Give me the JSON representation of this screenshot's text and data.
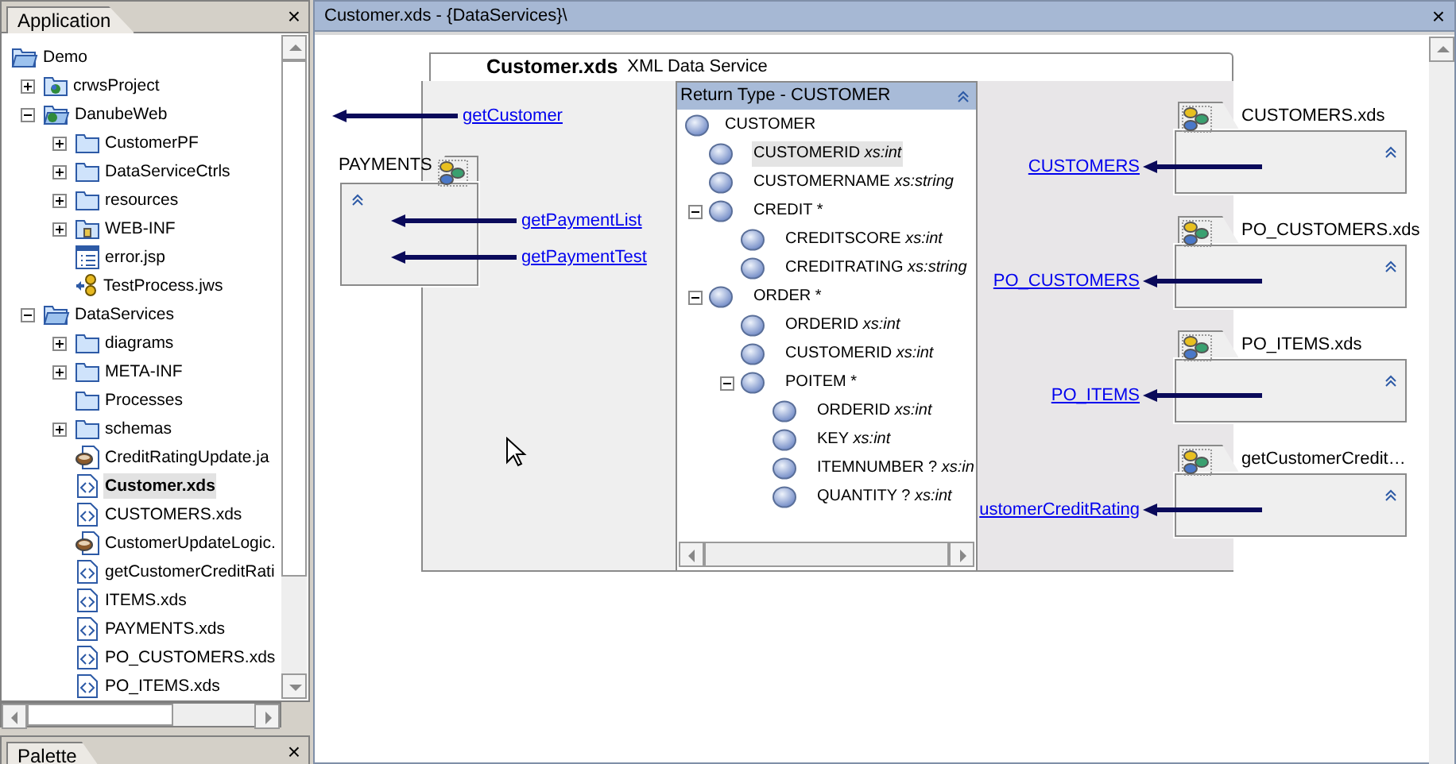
{
  "application_panel": {
    "tab": "Application",
    "close": "×"
  },
  "project_tree": [
    {
      "label": "Demo",
      "kind": "open-folder",
      "selected": false,
      "children": [
        {
          "label": "crwsProject",
          "kind": "project",
          "expanded": false,
          "selected": false
        },
        {
          "label": "DanubeWeb",
          "kind": "webapp",
          "expanded": true,
          "selected": false,
          "children": [
            {
              "label": "CustomerPF",
              "kind": "folder",
              "expanded": false,
              "selected": false
            },
            {
              "label": "DataServiceCtrls",
              "kind": "folder",
              "expanded": false,
              "selected": false
            },
            {
              "label": "resources",
              "kind": "folder",
              "expanded": false,
              "selected": false
            },
            {
              "label": "WEB-INF",
              "kind": "secure-folder",
              "expanded": false,
              "selected": false
            },
            {
              "label": "error.jsp",
              "kind": "jsp",
              "selected": false
            },
            {
              "label": "TestProcess.jws",
              "kind": "jws",
              "selected": false
            }
          ]
        },
        {
          "label": "DataServices",
          "kind": "open-folder",
          "expanded": true,
          "selected": false,
          "children": [
            {
              "label": "diagrams",
              "kind": "folder",
              "expanded": false,
              "selected": false
            },
            {
              "label": "META-INF",
              "kind": "folder",
              "expanded": false,
              "selected": false
            },
            {
              "label": "Processes",
              "kind": "folder",
              "selected": false
            },
            {
              "label": "schemas",
              "kind": "folder",
              "expanded": false,
              "selected": false
            },
            {
              "label": "CreditRatingUpdate.ja",
              "kind": "java",
              "selected": false
            },
            {
              "label": "Customer.xds",
              "kind": "xds",
              "selected": true
            },
            {
              "label": "CUSTOMERS.xds",
              "kind": "xds",
              "selected": false
            },
            {
              "label": "CustomerUpdateLogic.",
              "kind": "java",
              "selected": false
            },
            {
              "label": "getCustomerCreditRati",
              "kind": "xds",
              "selected": false
            },
            {
              "label": "ITEMS.xds",
              "kind": "xds",
              "selected": false
            },
            {
              "label": "PAYMENTS.xds",
              "kind": "xds",
              "selected": false
            },
            {
              "label": "PO_CUSTOMERS.xds",
              "kind": "xds",
              "selected": false
            },
            {
              "label": "PO_ITEMS.xds",
              "kind": "xds",
              "selected": false
            }
          ]
        }
      ]
    }
  ],
  "palette_panel": {
    "tab": "Palette",
    "close": "×"
  },
  "editor": {
    "title": "Customer.xds - {DataServices}\\",
    "close": "×"
  },
  "service": {
    "name": "Customer.xds",
    "subtitle": "XML Data Service",
    "functions": [
      "getCustomer"
    ],
    "return_type": {
      "title": "Return Type - CUSTOMER",
      "tree": [
        {
          "name": "CUSTOMER",
          "selected": false,
          "children": [
            {
              "name": "CUSTOMERID",
              "type": "xs:int",
              "selected": true
            },
            {
              "name": "CUSTOMERNAME",
              "type": "xs:string",
              "selected": false
            },
            {
              "name": "CREDIT *",
              "expanded": true,
              "selected": false,
              "children": [
                {
                  "name": "CREDITSCORE",
                  "type": "xs:int",
                  "selected": false
                },
                {
                  "name": "CREDITRATING",
                  "type": "xs:string",
                  "selected": false
                }
              ]
            },
            {
              "name": "ORDER *",
              "expanded": true,
              "selected": false,
              "children": [
                {
                  "name": "ORDERID",
                  "type": "xs:int",
                  "selected": false
                },
                {
                  "name": "CUSTOMERID",
                  "type": "xs:int",
                  "selected": false
                },
                {
                  "name": "POITEM *",
                  "expanded": true,
                  "selected": false,
                  "children": [
                    {
                      "name": "ORDERID",
                      "type": "xs:int",
                      "selected": false
                    },
                    {
                      "name": "KEY",
                      "type": "xs:int",
                      "selected": false
                    },
                    {
                      "name": "ITEMNUMBER ?",
                      "type": "xs:in",
                      "selected": false
                    },
                    {
                      "name": "QUANTITY ?",
                      "type": "xs:int",
                      "selected": false
                    }
                  ]
                }
              ]
            }
          ]
        }
      ]
    }
  },
  "payments": {
    "name": "PAYMENTS",
    "functions": [
      "getPaymentList",
      "getPaymentTest"
    ]
  },
  "data_sources": [
    {
      "name": "CUSTOMERS.xds",
      "function": "CUSTOMERS"
    },
    {
      "name": "PO_CUSTOMERS.xds",
      "function": "PO_CUSTOMERS"
    },
    {
      "name": "PO_ITEMS.xds",
      "function": "PO_ITEMS"
    },
    {
      "name": "getCustomerCredit…",
      "function": "ustomerCreditRating"
    }
  ]
}
